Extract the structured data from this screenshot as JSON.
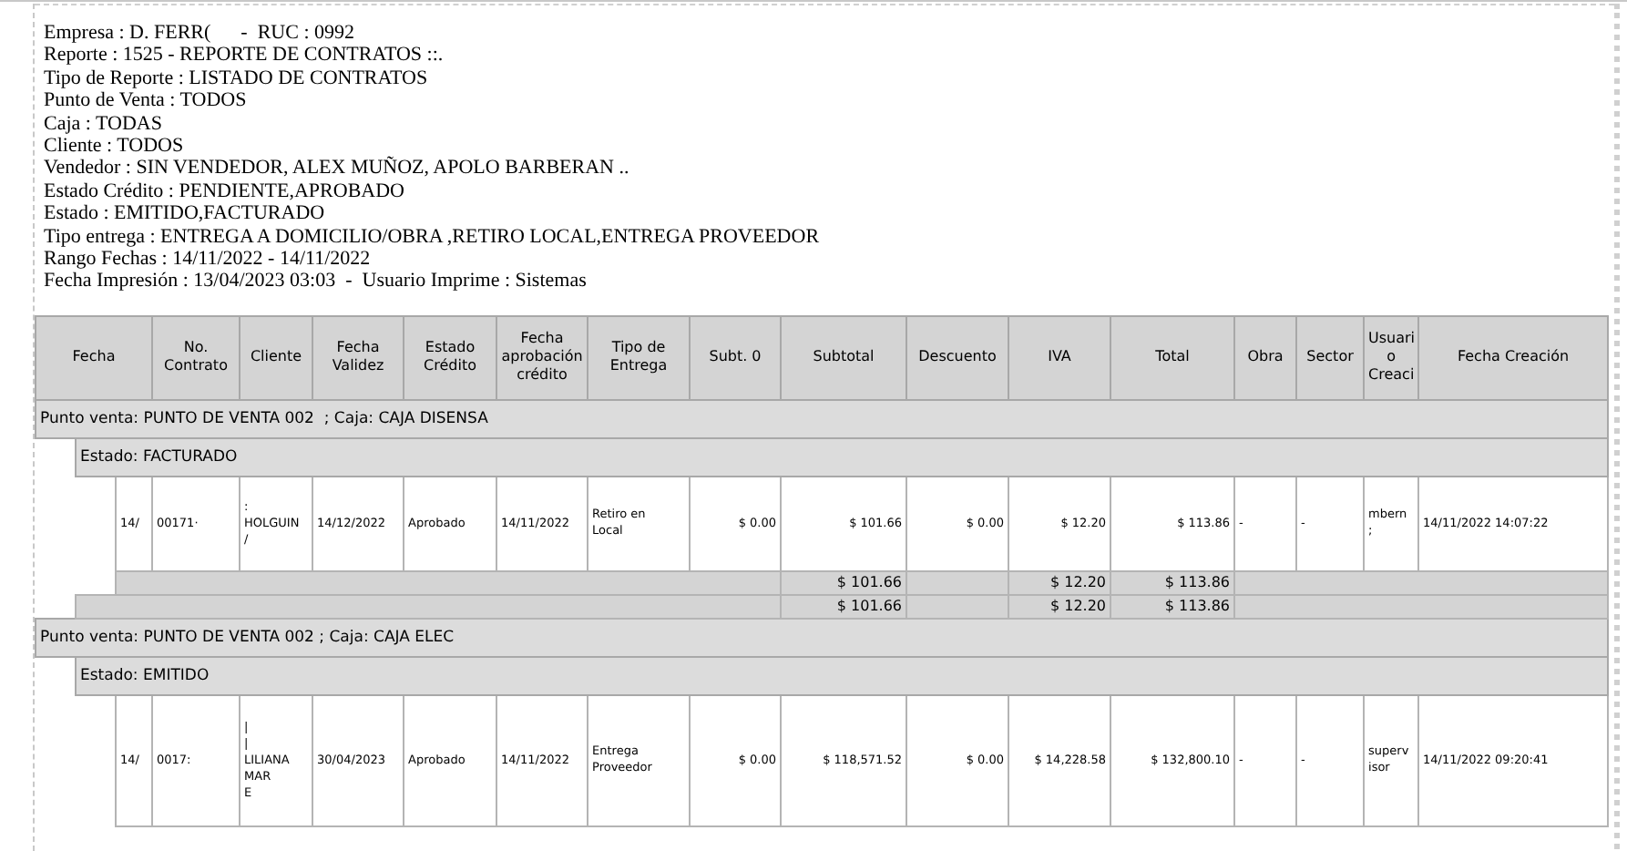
{
  "report_header": {
    "lines": [
      "Empresa : D. FERR(      -  RUC : 0992",
      "Reporte : 1525 - REPORTE DE CONTRATOS ::.",
      "Tipo de Reporte : LISTADO DE CONTRATOS",
      "Punto de Venta : TODOS",
      "Caja : TODAS",
      "Cliente : TODOS",
      "Vendedor : SIN VENDEDOR, ALEX MUÑOZ, APOLO BARBERAN ..",
      "Estado Crédito : PENDIENTE,APROBADO",
      "Estado : EMITIDO,FACTURADO",
      "Tipo entrega : ENTREGA A DOMICILIO/OBRA ,RETIRO LOCAL,ENTREGA PROVEEDOR",
      "Rango Fechas : 14/11/2022 - 14/11/2022",
      "Fecha Impresión : 13/04/2023 03:03  -  Usuario Imprime : Sistemas"
    ]
  },
  "table": {
    "columns": [
      "Fecha",
      "No.\nContrato",
      "Cliente",
      "Fecha\nValidez",
      "Estado\nCrédito",
      "Fecha\naprobación\ncrédito",
      "Tipo de\nEntrega",
      "Subt. 0",
      "Subtotal",
      "Descuento",
      "IVA",
      "Total",
      "Obra",
      "Sector",
      "Usuari\no\nCreaci",
      "Fecha Creación"
    ],
    "groups": [
      {
        "label": "Punto venta: PUNTO DE VENTA 002  ; Caja: CAJA DISENSA",
        "estados": [
          {
            "label": "Estado: FACTURADO",
            "rows": [
              {
                "cells": [
                  "14/",
                  "00171·",
                  ":\nHOLGUIN\n/",
                  "14/12/2022",
                  "Aprobado",
                  "14/11/2022",
                  "Retiro en\nLocal",
                  "$ 0.00",
                  "$ 101.66",
                  "$ 0.00",
                  "$ 12.20",
                  "$ 113.86",
                  "-",
                  "-",
                  "mbern\n;",
                  "14/11/2022  14:07:22"
                ]
              }
            ],
            "totals": {
              "subtotal": "$ 101.66",
              "iva": "$ 12.20",
              "total": "$ 113.86"
            }
          }
        ],
        "totals": {
          "subtotal": "$ 101.66",
          "iva": "$ 12.20",
          "total": "$ 113.86"
        }
      },
      {
        "label": "Punto venta: PUNTO DE VENTA 002 ; Caja: CAJA ELEC",
        "estados": [
          {
            "label": "Estado: EMITIDO",
            "rows": [
              {
                "cells": [
                  "14/",
                  "0017:",
                  "|\n|\nLILIANA\nMAR\nE",
                  "30/04/2023",
                  "Aprobado",
                  "14/11/2022",
                  "Entrega\nProveedor",
                  "$ 0.00",
                  "$ 118,571.52",
                  "$ 0.00",
                  "$ 14,228.58",
                  "$ 132,800.10",
                  "-",
                  "-",
                  "superv\nisor",
                  "14/11/2022  09:20:41"
                ]
              }
            ]
          }
        ]
      }
    ]
  }
}
